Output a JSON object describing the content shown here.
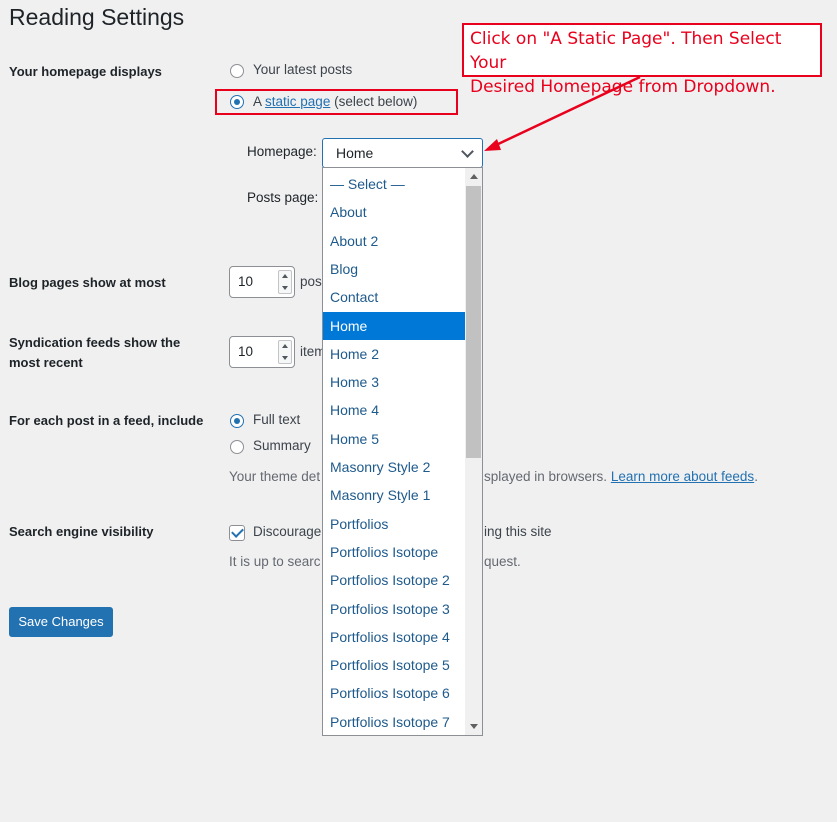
{
  "page_title": "Reading Settings",
  "homepage": {
    "label": "Your homepage displays",
    "latest_posts": "Your latest posts",
    "static_prefix": "A",
    "static_link": "static page",
    "static_suffix": "(select below)",
    "homepage_label": "Homepage:",
    "homepage_value": "Home",
    "posts_page_label": "Posts page:"
  },
  "blog_pages": {
    "label": "Blog pages show at most",
    "value": "10",
    "unit_partial": "pos"
  },
  "syndication": {
    "label_line1": "Syndication feeds show the",
    "label_line2": "most recent",
    "value": "10",
    "unit_partial": "item"
  },
  "feed": {
    "label": "For each post in a feed, include",
    "full_text": "Full text",
    "summary": "Summary",
    "desc_left": "Your theme det",
    "desc_right": "splayed in browsers.",
    "desc_link": "Learn more about feeds",
    "desc_end": "."
  },
  "search": {
    "label": "Search engine visibility",
    "checkbox_partial": "Discourage",
    "checkbox_end": "ing this site",
    "desc_left": "It is up to searc",
    "desc_right": "quest."
  },
  "save_button": "Save Changes",
  "dropdown_options": [
    "— Select —",
    "About",
    "About 2",
    "Blog",
    "Contact",
    "Home",
    "Home 2",
    "Home 3",
    "Home 4",
    "Home 5",
    "Masonry Style 2",
    "Masonry Style 1",
    "Portfolios",
    "Portfolios Isotope",
    "Portfolios Isotope 2",
    "Portfolios Isotope 3",
    "Portfolios Isotope 4",
    "Portfolios Isotope 5",
    "Portfolios Isotope 6",
    "Portfolios Isotope 7"
  ],
  "dropdown_selected": "Home",
  "annotation": {
    "line1": "Click on \"A Static Page\". Then Select Your",
    "line2": "Desired Homepage from Dropdown."
  },
  "colors": {
    "accent": "#2271b1",
    "annotation_red": "#e8001c",
    "selected_bg": "#0078d7"
  }
}
